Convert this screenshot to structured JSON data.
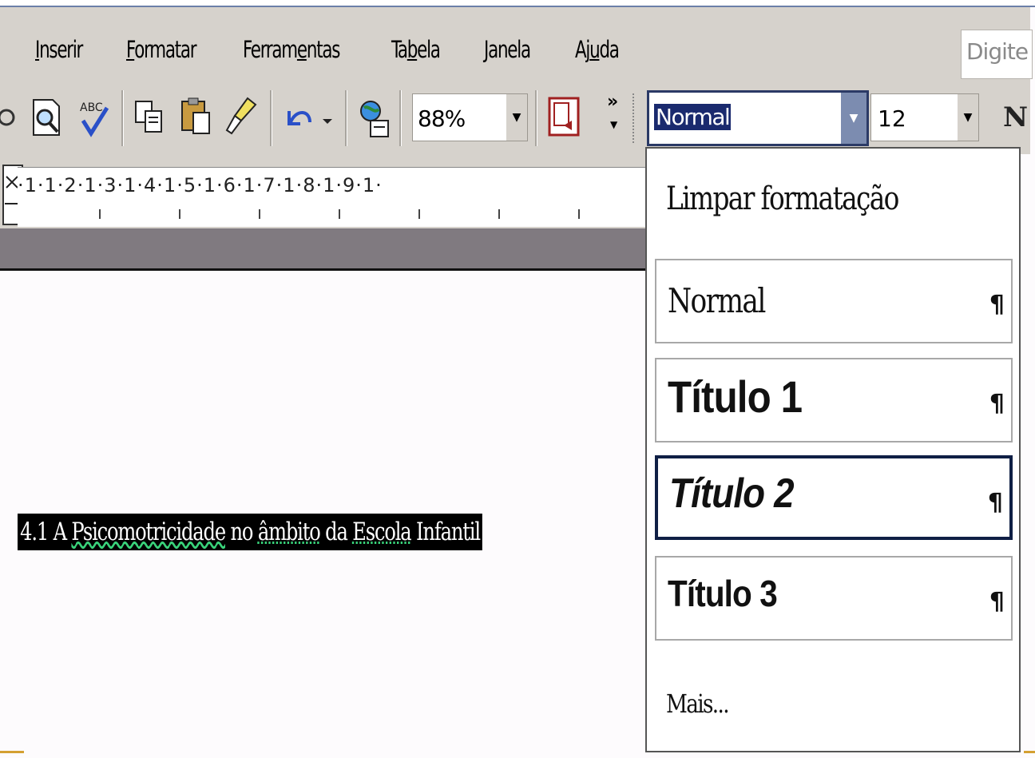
{
  "menubar": {
    "items": [
      {
        "label": "Inserir",
        "mnemonic_index": 0
      },
      {
        "label": "Formatar",
        "mnemonic_index": 0
      },
      {
        "label": "Ferramentas",
        "mnemonic_index": 6
      },
      {
        "label": "Tabela",
        "mnemonic_index": 2
      },
      {
        "label": "Janela",
        "mnemonic_index": 0
      },
      {
        "label": "Ajuda",
        "mnemonic_index": 2
      }
    ],
    "help_placeholder": "Digite u"
  },
  "toolbar": {
    "zoom": "88%",
    "style": "Normal",
    "font_size": "12",
    "bold_label": "N",
    "overflow": "»",
    "icons": [
      "print-preview-icon",
      "spelling-icon",
      "copy-icon",
      "paste-icon",
      "format-painter-icon",
      "undo-icon",
      "web-icon",
      "reading-layout-icon"
    ]
  },
  "ruler": {
    "text": "·1·1·2·1·3·1·4·1·5·1·6·1·7·1·8·1·9·1·"
  },
  "document": {
    "heading_prefix": "4.1 A ",
    "heading_word1": "Psicomotricidade",
    "heading_mid": " no ",
    "heading_word2": "âmbito",
    "heading_mid2": " da ",
    "heading_word3": "Escola",
    "heading_suffix": " Infantil"
  },
  "style_dropdown": {
    "clear": "Limpar formatação",
    "items": [
      {
        "label": "Normal",
        "mark": "¶"
      },
      {
        "label": "Título 1",
        "mark": "¶"
      },
      {
        "label": "Título 2",
        "mark": "¶"
      },
      {
        "label": "Título 3",
        "mark": "¶"
      }
    ],
    "more": "Mais..."
  },
  "colors": {
    "toolbar_bg": "#d6d2cc",
    "selection": "#1a2a6e",
    "spell_underline": "#39d27a"
  }
}
